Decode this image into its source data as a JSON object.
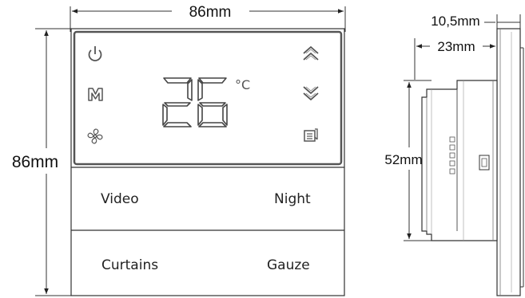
{
  "dimensions": {
    "front_width": "86mm",
    "front_height": "86mm",
    "side_plate_depth": "10,5mm",
    "side_total_depth": "23mm",
    "side_body_height": "52mm"
  },
  "display": {
    "temperature": "26",
    "unit": "°C"
  },
  "icons": {
    "left": [
      "power-icon",
      "mode-m-icon",
      "fan-icon"
    ],
    "right": [
      "chevron-up-icon",
      "chevron-down-icon",
      "exit-icon"
    ]
  },
  "keys": {
    "top_left": "Video",
    "top_right": "Night",
    "bottom_left": "Curtains",
    "bottom_right": "Gauze"
  }
}
